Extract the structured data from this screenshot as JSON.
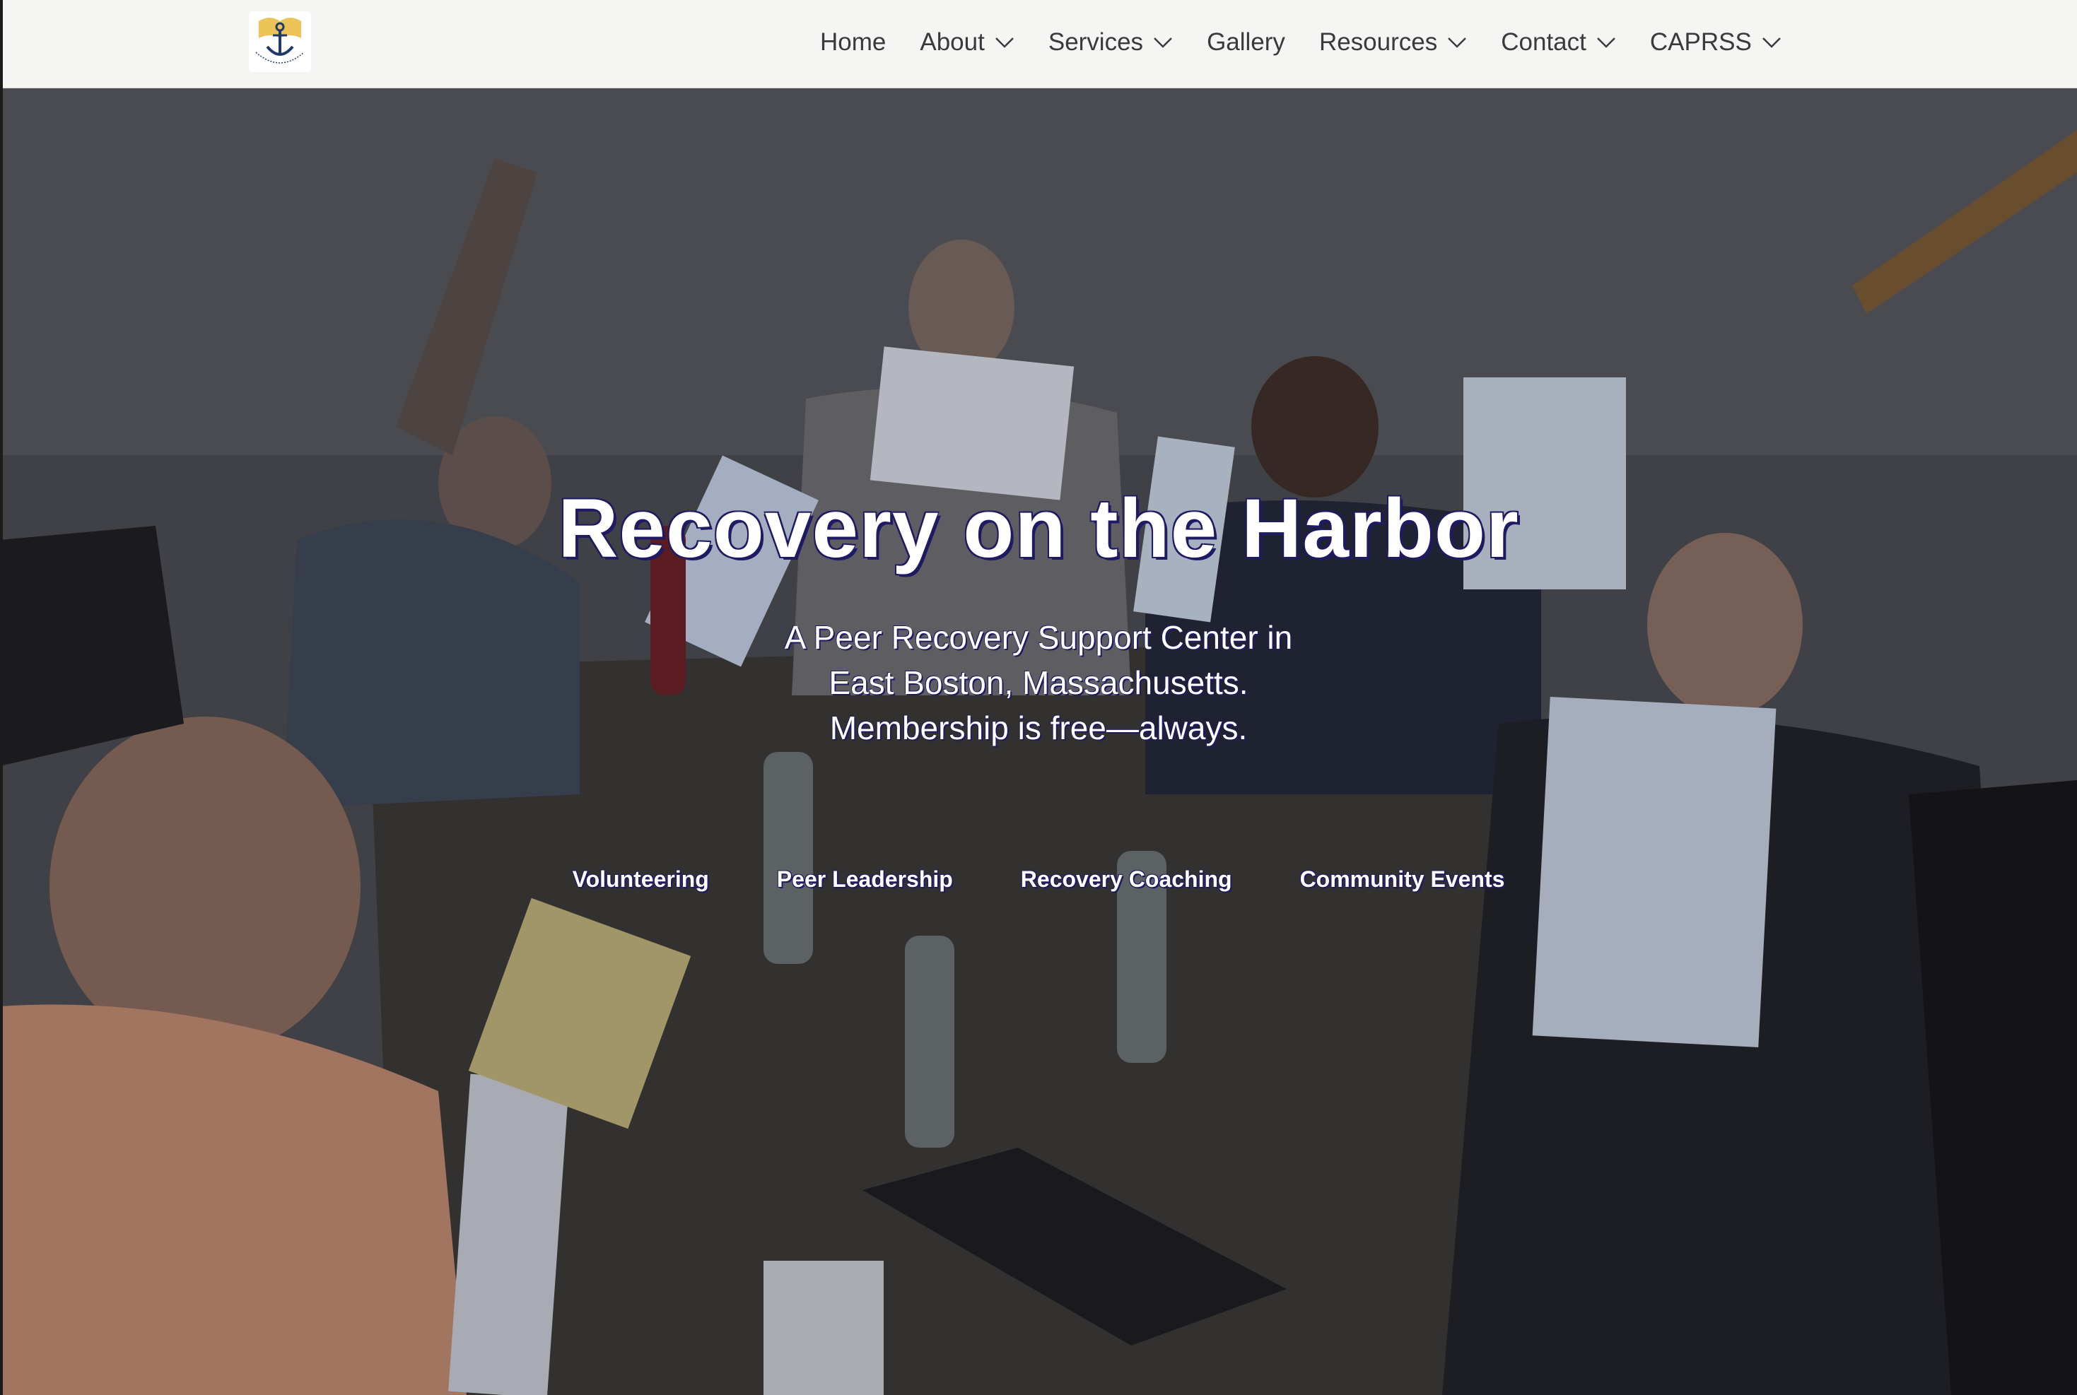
{
  "header": {
    "logo_icon": "anchor-logo-icon",
    "nav": [
      {
        "label": "Home",
        "dropdown": false
      },
      {
        "label": "About",
        "dropdown": true
      },
      {
        "label": "Services",
        "dropdown": true
      },
      {
        "label": "Gallery",
        "dropdown": false
      },
      {
        "label": "Resources",
        "dropdown": true
      },
      {
        "label": "Contact",
        "dropdown": true
      },
      {
        "label": "CAPRSS",
        "dropdown": true
      }
    ]
  },
  "hero": {
    "title": "Recovery on the Harbor",
    "subtitle_lines": [
      "A Peer Recovery Support Center in",
      "East Boston, Massachusetts.",
      "Membership is free—always."
    ],
    "links": [
      "Volunteering",
      "Peer Leadership",
      "Recovery Coaching",
      "Community Events"
    ]
  },
  "colors": {
    "header_bg": "#f5f5f4",
    "nav_text": "#3a3a3a",
    "hero_text": "#ffffff",
    "text_outline": "#1e1a63",
    "logo_navy": "#1f3a68",
    "logo_gold": "#e8b93a"
  }
}
